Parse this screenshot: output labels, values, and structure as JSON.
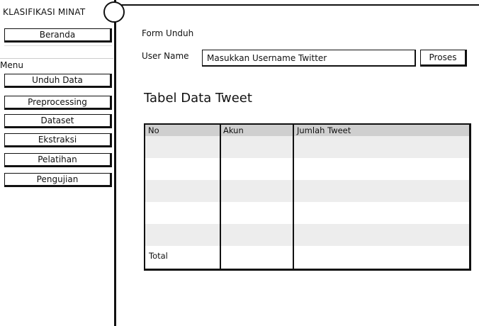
{
  "app": {
    "title": "KLASIFIKASI MINAT"
  },
  "sidebar": {
    "home_label": "Beranda",
    "menu_label": "Menu",
    "items": [
      {
        "label": "Unduh Data"
      },
      {
        "label": "Preprocessing"
      },
      {
        "label": "Dataset"
      },
      {
        "label": "Ekstraksi"
      },
      {
        "label": "Pelatihan"
      },
      {
        "label": "Pengujian"
      }
    ]
  },
  "form": {
    "title": "Form Unduh",
    "user_label": "User Name",
    "user_placeholder": "Masukkan Username Twitter",
    "submit_label": "Proses"
  },
  "table": {
    "title": "Tabel Data Tweet",
    "columns": [
      "No",
      "Akun",
      "Jumlah Tweet"
    ],
    "rows": [
      [
        "",
        "",
        ""
      ],
      [
        "",
        "",
        ""
      ],
      [
        "",
        "",
        ""
      ],
      [
        "",
        "",
        ""
      ],
      [
        "",
        "",
        ""
      ]
    ],
    "total_label": "Total"
  }
}
